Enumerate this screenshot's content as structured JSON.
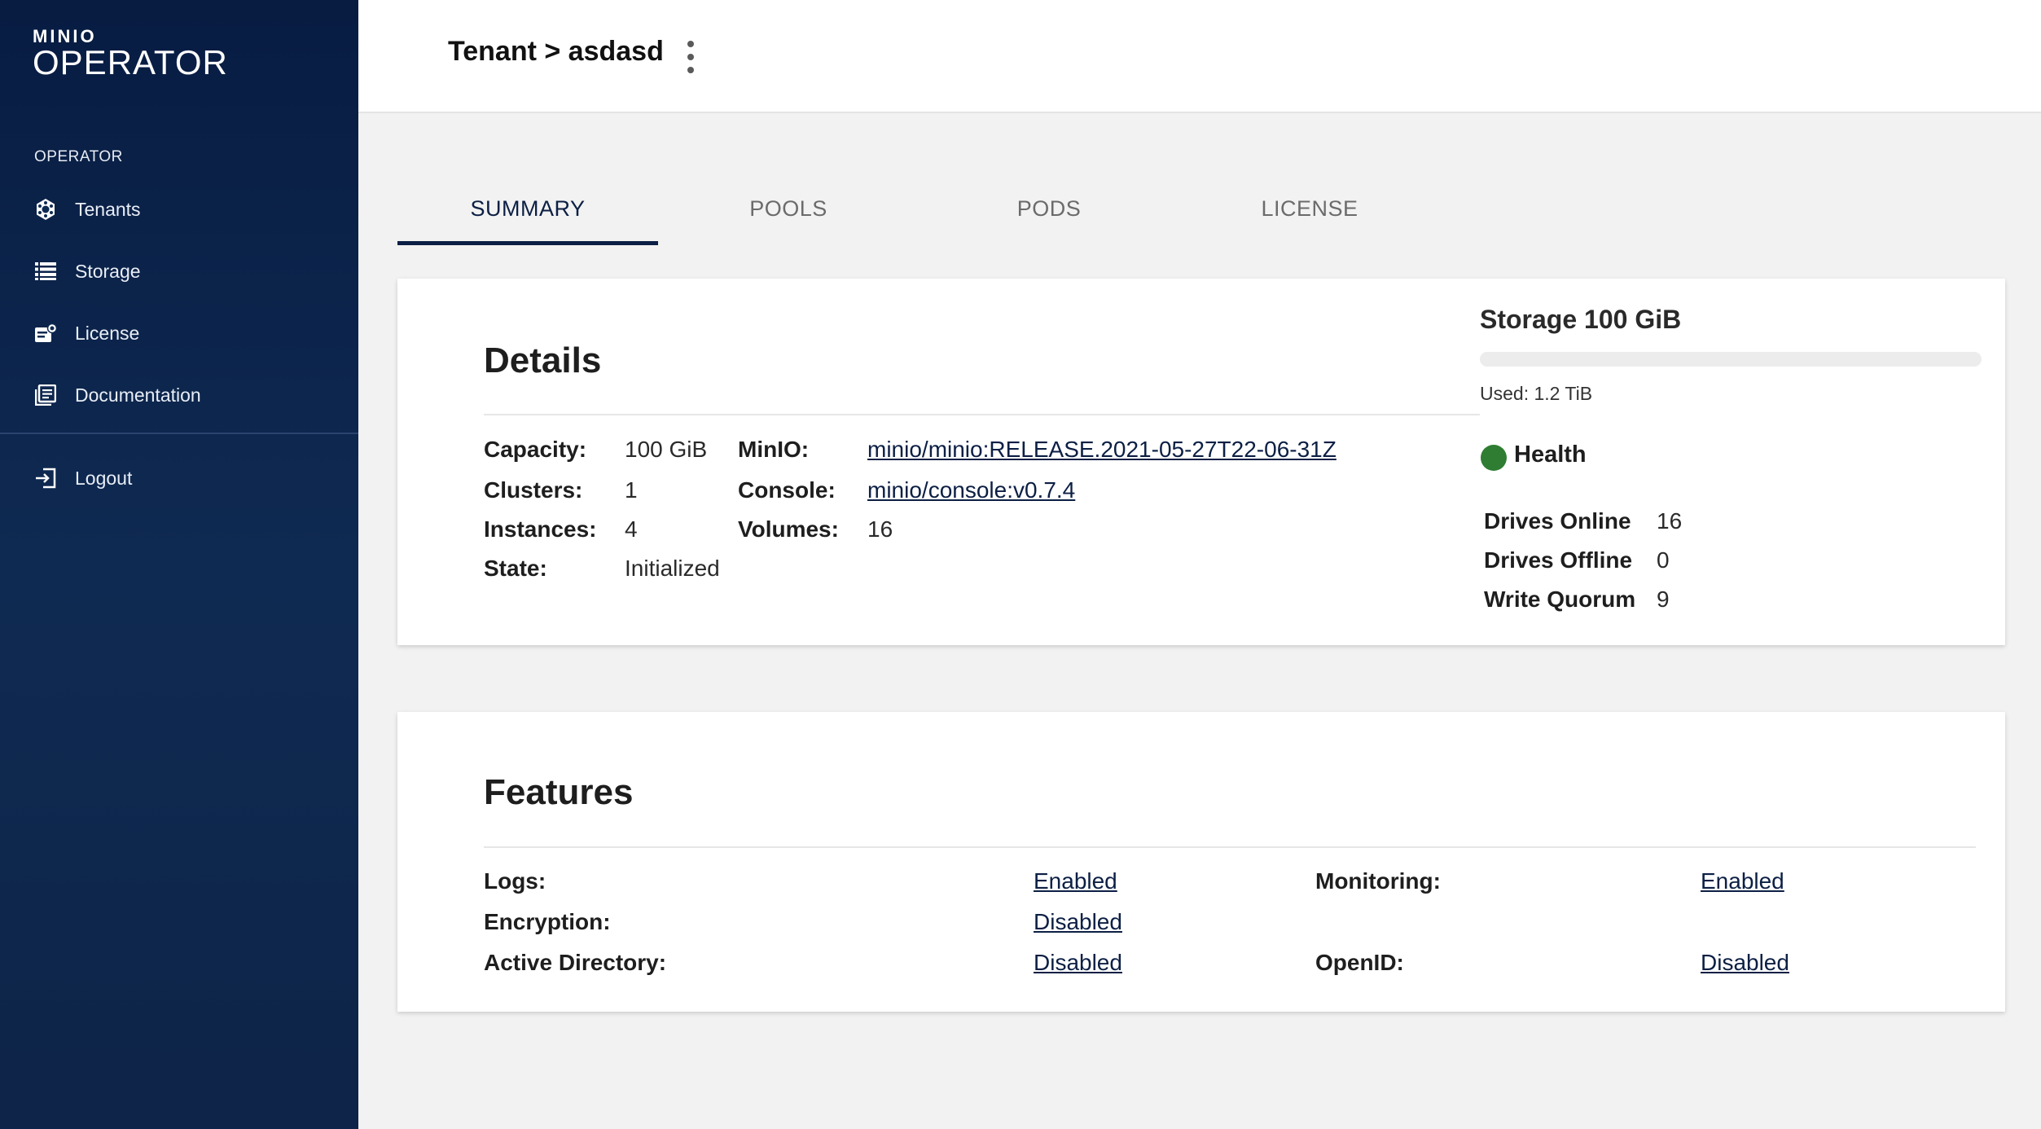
{
  "sidebar": {
    "logo_small": "MINIO",
    "logo_big": "OPERATOR",
    "section_label": "OPERATOR",
    "items": [
      {
        "label": "Tenants",
        "icon": "tenants-icon"
      },
      {
        "label": "Storage",
        "icon": "storage-icon"
      },
      {
        "label": "License",
        "icon": "license-icon"
      },
      {
        "label": "Documentation",
        "icon": "documentation-icon"
      }
    ],
    "logout_label": "Logout"
  },
  "header": {
    "title": "Tenant > asdasd"
  },
  "tabs": [
    {
      "label": "SUMMARY",
      "active": true
    },
    {
      "label": "POOLS",
      "active": false
    },
    {
      "label": "PODS",
      "active": false
    },
    {
      "label": "LICENSE",
      "active": false
    }
  ],
  "details": {
    "title": "Details",
    "capacity_label": "Capacity:",
    "capacity_value": "100 GiB",
    "clusters_label": "Clusters:",
    "clusters_value": "1",
    "instances_label": "Instances:",
    "instances_value": "4",
    "state_label": "State:",
    "state_value": "Initialized",
    "minio_label": "MinIO:",
    "minio_value": "minio/minio:RELEASE.2021-05-27T22-06-31Z",
    "console_label": "Console:",
    "console_value": "minio/console:v0.7.4",
    "volumes_label": "Volumes:",
    "volumes_value": "16"
  },
  "storage": {
    "title": "Storage 100 GiB",
    "used_label": "Used: 1.2 TiB",
    "usage_fraction": 0,
    "health_label": "Health",
    "health_color": "#2e7d32",
    "drives_online_label": "Drives Online",
    "drives_online_value": "16",
    "drives_offline_label": "Drives Offline",
    "drives_offline_value": "0",
    "write_quorum_label": "Write Quorum",
    "write_quorum_value": "9"
  },
  "features": {
    "title": "Features",
    "logs_label": "Logs:",
    "logs_value": "Enabled",
    "encryption_label": "Encryption:",
    "encryption_value": "Disabled",
    "active_directory_label": "Active Directory:",
    "active_directory_value": "Disabled",
    "monitoring_label": "Monitoring:",
    "monitoring_value": "Enabled",
    "openid_label": "OpenID:",
    "openid_value": "Disabled"
  },
  "colors": {
    "sidebar_bg": "#0f2a52",
    "accent": "#0c1f44"
  }
}
